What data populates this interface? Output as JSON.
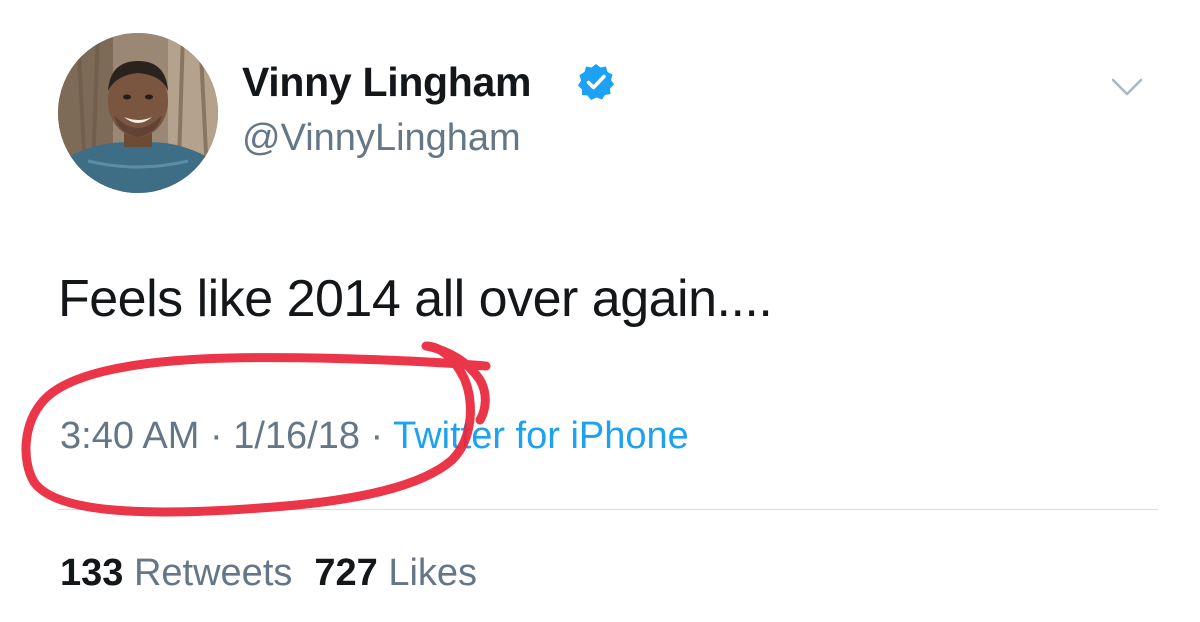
{
  "author": {
    "display_name": "Vinny Lingham",
    "handle": "@VinnyLingham",
    "verified_icon": "verified-badge-icon",
    "avatar_icon": "profile-photo"
  },
  "tweet": {
    "text": "Feels like 2014 all over again....",
    "time": "3:40 AM",
    "separator": " · ",
    "date": "1/16/18",
    "source": "Twitter for iPhone"
  },
  "stats": {
    "retweets_count": "133",
    "retweets_label": "Retweets",
    "likes_count": "727",
    "likes_label": "Likes"
  },
  "colors": {
    "verified": "#1da1f2",
    "secondary_text": "#657786",
    "link": "#1da1f2",
    "annotation": "#e8273a"
  }
}
